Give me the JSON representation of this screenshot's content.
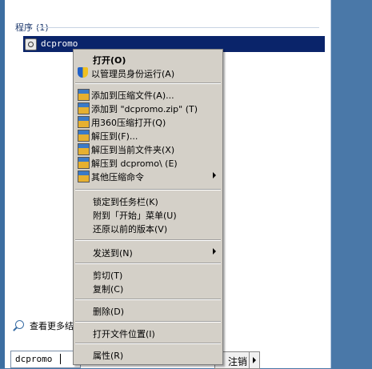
{
  "results": {
    "section_title": "程序",
    "section_count": "(1)",
    "selected_program": "dcpromo"
  },
  "see_more": "查看更多结果",
  "search": {
    "value": "dcpromo"
  },
  "power": {
    "logoff_label": "注销"
  },
  "context_menu": {
    "items": [
      {
        "label": "打开(O)",
        "icon": "none",
        "bold": true
      },
      {
        "label": "以管理员身份运行(A)",
        "icon": "shield-icon"
      },
      {
        "label": "添加到压缩文件(A)...",
        "icon": "archive-icon"
      },
      {
        "label": "添加到 \"dcpromo.zip\" (T)",
        "icon": "archive-icon"
      },
      {
        "label": "用360压缩打开(Q)",
        "icon": "archive-icon"
      },
      {
        "label": "解压到(F)...",
        "icon": "archive-icon"
      },
      {
        "label": "解压到当前文件夹(X)",
        "icon": "archive-icon"
      },
      {
        "label": "解压到 dcpromo\\ (E)",
        "icon": "archive-icon"
      },
      {
        "label": "其他压缩命令",
        "icon": "archive-icon",
        "submenu": true
      },
      {
        "label": "锁定到任务栏(K)"
      },
      {
        "label": "附到「开始」菜单(U)"
      },
      {
        "label": "还原以前的版本(V)"
      },
      {
        "label": "发送到(N)",
        "submenu": true
      },
      {
        "label": "剪切(T)"
      },
      {
        "label": "复制(C)"
      },
      {
        "label": "删除(D)"
      },
      {
        "label": "打开文件位置(I)"
      },
      {
        "label": "属性(R)"
      }
    ]
  }
}
